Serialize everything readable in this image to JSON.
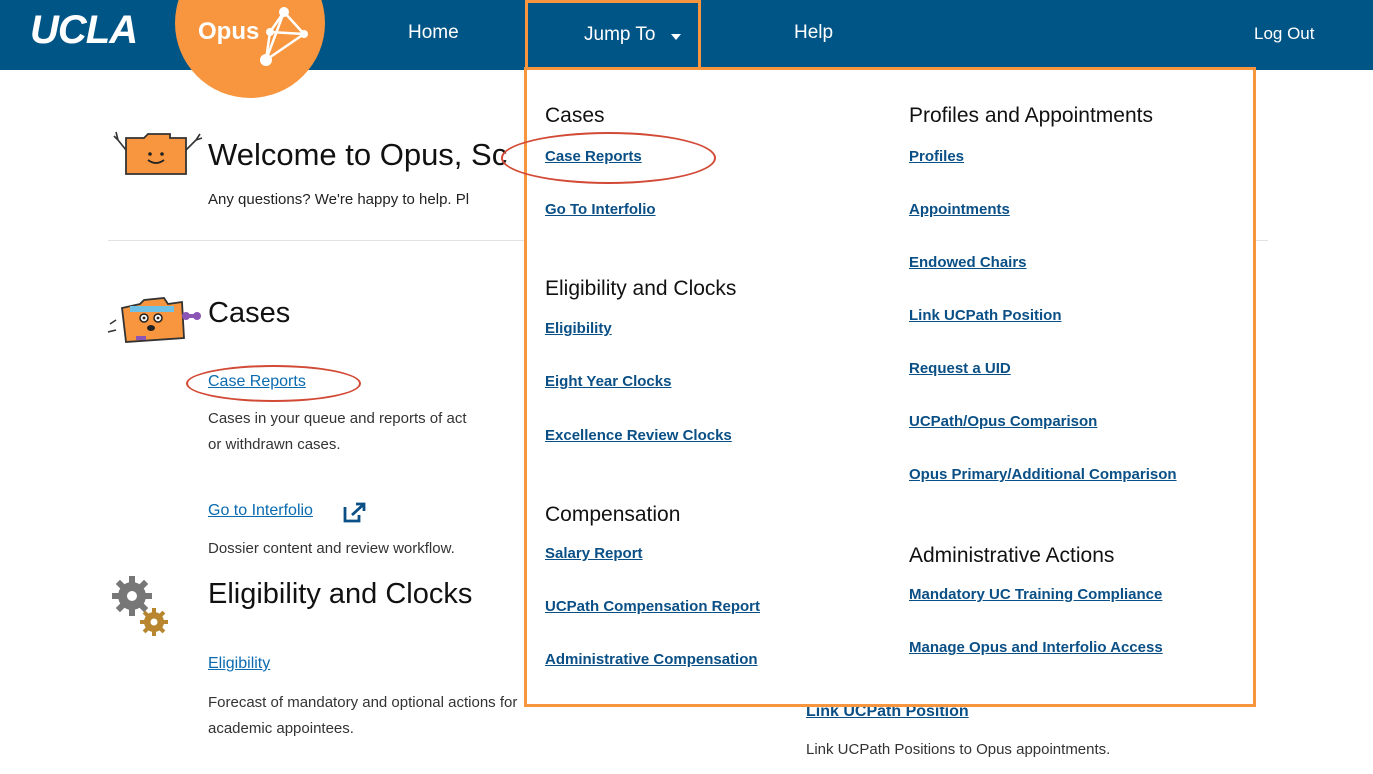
{
  "header": {
    "logo_ucla": "UCLA",
    "logo_opus": "Opus",
    "nav": {
      "home": "Home",
      "jump_to": "Jump To",
      "help": "Help",
      "logout": "Log Out"
    }
  },
  "welcome": {
    "title": "Welcome to Opus, Sc",
    "subtitle": "Any questions? We're happy to help. Pl"
  },
  "cases_section": {
    "title": "Cases",
    "case_reports_link": "Case Reports",
    "case_reports_desc_line1": "Cases in your queue and reports of act",
    "case_reports_desc_line2": "or withdrawn cases.",
    "interfolio_link": "Go to Interfolio",
    "interfolio_desc": "Dossier content and review workflow."
  },
  "eligibility_section": {
    "title": "Eligibility and Clocks",
    "eligibility_link": "Eligibility",
    "eligibility_desc_line1": "Forecast of mandatory and optional actions for",
    "eligibility_desc_line2": "academic appointees."
  },
  "right_column": {
    "link_ucpath_link": "Link UCPath Position",
    "link_ucpath_desc": "Link UCPath Positions to Opus appointments."
  },
  "dropdown": {
    "cases": {
      "heading": "Cases",
      "items": [
        "Case Reports",
        "Go To Interfolio"
      ]
    },
    "eligibility": {
      "heading": "Eligibility and Clocks",
      "items": [
        "Eligibility",
        "Eight Year Clocks",
        "Excellence Review Clocks"
      ]
    },
    "compensation": {
      "heading": "Compensation",
      "items": [
        "Salary Report",
        "UCPath Compensation Report",
        "Administrative Compensation"
      ]
    },
    "profiles": {
      "heading": "Profiles and Appointments",
      "items": [
        "Profiles",
        "Appointments",
        "Endowed Chairs",
        "Link UCPath Position",
        "Request a UID",
        "UCPath/Opus Comparison",
        "Opus Primary/Additional Comparison"
      ]
    },
    "admin": {
      "heading": "Administrative Actions",
      "items": [
        "Mandatory UC Training Compliance",
        "Manage Opus and Interfolio Access"
      ]
    }
  },
  "colors": {
    "header_bg": "#005587",
    "accent_orange": "#f7963f",
    "annotation_red": "#d24a36",
    "link_blue": "#0a6bb0"
  }
}
